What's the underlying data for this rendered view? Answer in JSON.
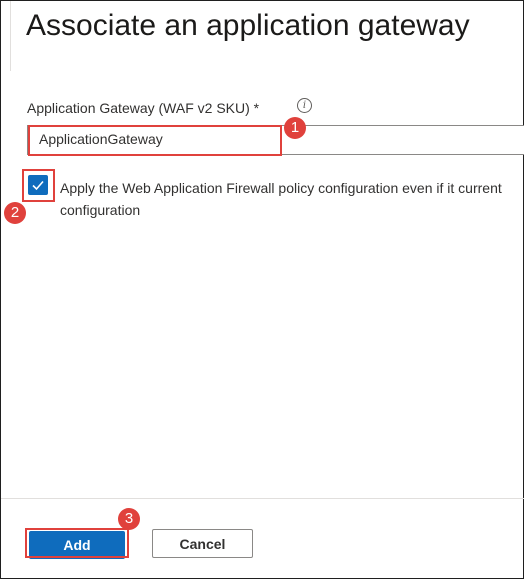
{
  "panel": {
    "title": "Associate an application gateway"
  },
  "gateway_field": {
    "label": "Application Gateway (WAF v2 SKU) *",
    "info_icon_glyph": "i",
    "value": "ApplicationGateway"
  },
  "waf_checkbox": {
    "checked": true,
    "label": "Apply the Web Application Firewall policy configuration even if it current configuration"
  },
  "footer": {
    "add_label": "Add",
    "cancel_label": "Cancel"
  },
  "callouts": {
    "badge_1": "1",
    "badge_2": "2",
    "badge_3": "3",
    "color": "#e0413c"
  },
  "colors": {
    "accent": "#0f6cbd"
  }
}
